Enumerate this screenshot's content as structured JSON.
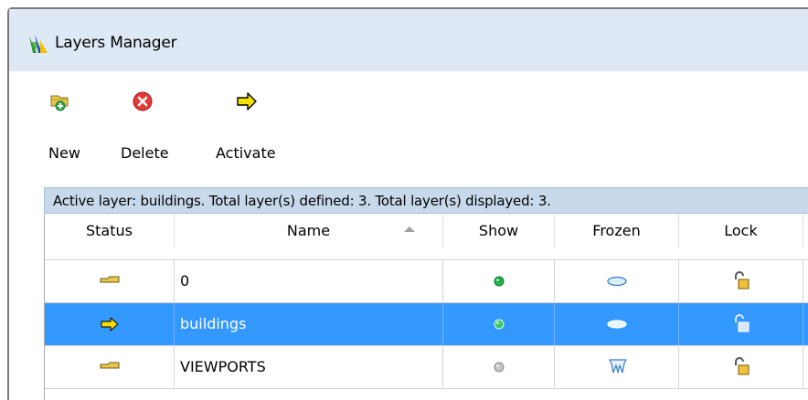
{
  "window": {
    "title": "Layers Manager",
    "logo_icon": "layers-manager-logo-icon"
  },
  "toolbar": {
    "new_label": "New",
    "delete_label": "Delete",
    "activate_label": "Activate"
  },
  "info": "Active layer: buildings. Total layer(s) defined: 3. Total layer(s) displayed: 3.",
  "columns": {
    "status": "Status",
    "name": "Name",
    "show": "Show",
    "frozen": "Frozen",
    "lock": "Lock"
  },
  "sort": {
    "column": "name",
    "direction": "ascending"
  },
  "layers": [
    {
      "name": "0",
      "status": "folder-icon",
      "show": "on",
      "frozen": "thawed",
      "lock": "unlocked",
      "selected": false
    },
    {
      "name": "buildings",
      "status": "active-arrow-icon",
      "show": "on",
      "frozen": "thawed",
      "lock": "unlocked",
      "selected": true
    },
    {
      "name": "VIEWPORTS",
      "status": "folder-icon",
      "show": "off",
      "frozen": "frozen",
      "lock": "unlocked",
      "selected": false
    }
  ],
  "colors": {
    "selection": "#3399ff",
    "info_bar": "#c9d9ec",
    "titlebar": "#dfe9f5",
    "show_on": "#22b14c",
    "show_off": "#b4b4b4",
    "folder": "#e8c84a",
    "activate_arrow": "#f5e000"
  }
}
